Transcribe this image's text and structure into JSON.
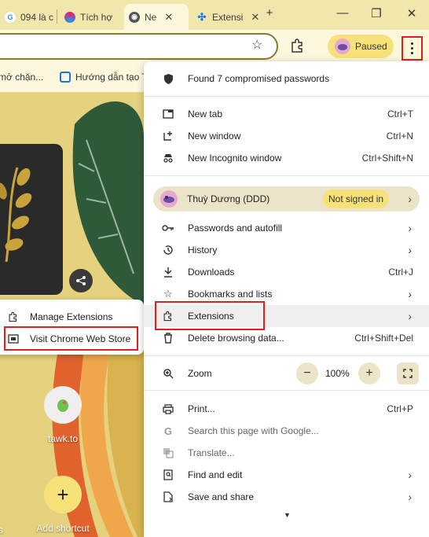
{
  "tabs": [
    {
      "title": "094 là c"
    },
    {
      "title": "Tích hợ"
    },
    {
      "title": "Ne"
    },
    {
      "title": "Extensi"
    }
  ],
  "toolbar": {
    "profile_status": "Paused"
  },
  "bookmarks": [
    {
      "label": "mở chặn..."
    },
    {
      "label": "Hướng dẫn tạo T"
    }
  ],
  "shortcuts": [
    {
      "label": "tawk.to"
    },
    {
      "label": "Add shortcut"
    },
    {
      "label": "s"
    }
  ],
  "extension_flyout": {
    "items": [
      {
        "label": "Manage Extensions"
      },
      {
        "label": "Visit Chrome Web Store"
      }
    ]
  },
  "menu": {
    "found_passwords": "Found 7 compromised passwords",
    "new_tab": {
      "label": "New tab",
      "shortcut": "Ctrl+T"
    },
    "new_window": {
      "label": "New window",
      "shortcut": "Ctrl+N"
    },
    "new_incognito": {
      "label": "New Incognito window",
      "shortcut": "Ctrl+Shift+N"
    },
    "profile": {
      "name": "Thuỳ Dương (DDD)",
      "status": "Not signed in"
    },
    "passwords": {
      "label": "Passwords and autofill"
    },
    "history": {
      "label": "History"
    },
    "downloads": {
      "label": "Downloads",
      "shortcut": "Ctrl+J"
    },
    "bookmarks": {
      "label": "Bookmarks and lists"
    },
    "extensions": {
      "label": "Extensions"
    },
    "delete_data": {
      "label": "Delete browsing data...",
      "shortcut": "Ctrl+Shift+Del"
    },
    "zoom": {
      "label": "Zoom",
      "minus": "−",
      "value": "100%",
      "plus": "+"
    },
    "print": {
      "label": "Print...",
      "shortcut": "Ctrl+P"
    },
    "search_page": {
      "label": "Search this page with Google..."
    },
    "translate": {
      "label": "Translate..."
    },
    "find_edit": {
      "label": "Find and edit"
    },
    "save_share": {
      "label": "Save and share"
    }
  },
  "colors": {
    "highlight_box": "#e02020",
    "badge": "#f7e27a",
    "toolbar": "#fdf8dd",
    "tabstrip": "#f1e7ad"
  }
}
